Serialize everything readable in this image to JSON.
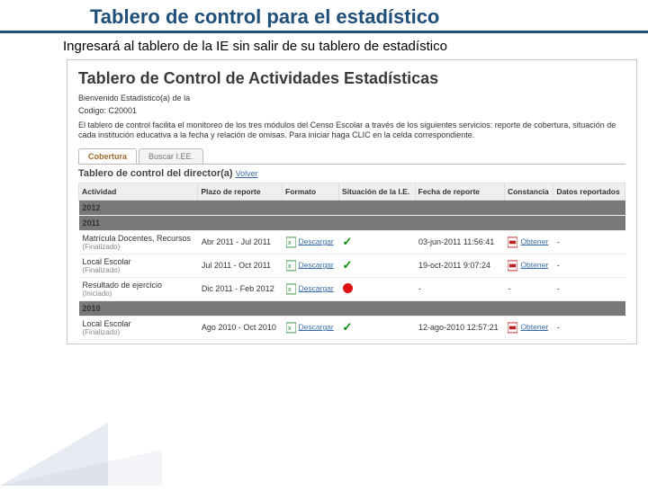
{
  "slide": {
    "title": "Tablero de control para el estadístico",
    "subtitle": "Ingresará al tablero de la IE sin salir de su tablero de estadístico"
  },
  "app": {
    "heading": "Tablero de Control de Actividades Estadísticas",
    "welcome": "Bienvenido Estadístico(a) de la",
    "code_label": "Codigo: C20001",
    "description": "El tablero de control facilita el monitoreo de los tres módulos del Censo Escolar a través de los siguientes servicios: reporte de cobertura, situación de cada institución educativa a la fecha y relación de omisas. Para iniciar haga CLIC en la celda correspondiente.",
    "tabs": [
      {
        "label": "Cobertura",
        "active": true
      },
      {
        "label": "Buscar I.EE.",
        "active": false
      }
    ],
    "panel_title": "Tablero de control del director(a)",
    "volver": "Volver",
    "columns": {
      "actividad": "Actividad",
      "plazo": "Plazo de reporte",
      "formato": "Formato",
      "situacion": "Situación de la I.E.",
      "fecha": "Fecha de reporte",
      "constancia": "Constancia",
      "datos": "Datos reportados"
    },
    "download_label": "Descargar",
    "obtener_label": "Obtener",
    "years": {
      "y2012": "2012",
      "y2011": "2011",
      "y2010": "2010"
    },
    "rows": {
      "r1": {
        "activity": "Matrícula Docentes, Recursos",
        "status": "(Finalizado)",
        "plazo": "Abr 2011 - Jul 2011",
        "situacion": "check",
        "fecha": "03-jun-2011 11:56:41",
        "constancia": "obtener",
        "datos": "-"
      },
      "r2": {
        "activity": "Local Escolar",
        "status": "(Finalizado)",
        "plazo": "Jul 2011 - Oct 2011",
        "situacion": "check",
        "fecha": "19-oct-2011 9:07:24",
        "constancia": "obtener",
        "datos": "-"
      },
      "r3": {
        "activity": "Resultado de ejercicio",
        "status": "(Iniciado)",
        "plazo": "Dic 2011 - Feb 2012",
        "situacion": "red",
        "fecha": "-",
        "constancia": "-",
        "datos": "-"
      },
      "r4": {
        "activity": "Local Escolar",
        "status": "(Finalizado)",
        "plazo": "Ago 2010 - Oct 2010",
        "situacion": "check",
        "fecha": "12-ago-2010 12:57:21",
        "constancia": "obtener",
        "datos": "-"
      }
    }
  }
}
